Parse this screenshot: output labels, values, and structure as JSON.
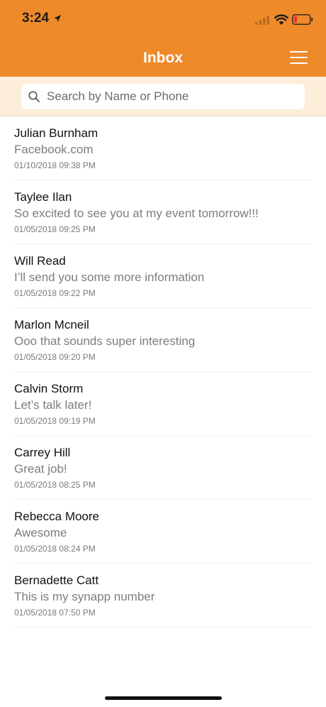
{
  "status_bar": {
    "time": "3:24"
  },
  "header": {
    "title": "Inbox",
    "menu_icon": "hamburger-menu-icon"
  },
  "search": {
    "placeholder": "Search by Name or Phone",
    "value": "",
    "icon": "search-icon"
  },
  "colors": {
    "header_bg": "#ef8a2b",
    "search_band_bg": "#fdeed9",
    "battery_low": "#e5332a"
  },
  "messages": [
    {
      "name": "Julian Burnham",
      "preview": "Facebook.com",
      "time": "01/10/2018 09:38 PM"
    },
    {
      "name": "Taylee Ilan",
      "preview": "So excited to see you at my event tomorrow!!!",
      "time": "01/05/2018 09:25 PM"
    },
    {
      "name": "Will Read",
      "preview": "I’ll send you some more information",
      "time": "01/05/2018 09:22 PM"
    },
    {
      "name": "Marlon Mcneil",
      "preview": "Ooo that sounds super interesting",
      "time": "01/05/2018 09:20 PM"
    },
    {
      "name": "Calvin Storm",
      "preview": "Let’s talk later!",
      "time": "01/05/2018 09:19 PM"
    },
    {
      "name": "Carrey Hill",
      "preview": "Great job!",
      "time": "01/05/2018 08:25 PM"
    },
    {
      "name": "Rebecca Moore",
      "preview": "Awesome",
      "time": "01/05/2018 08:24 PM"
    },
    {
      "name": "Bernadette Catt",
      "preview": "This is my synapp number",
      "time": "01/05/2018 07:50 PM"
    }
  ]
}
